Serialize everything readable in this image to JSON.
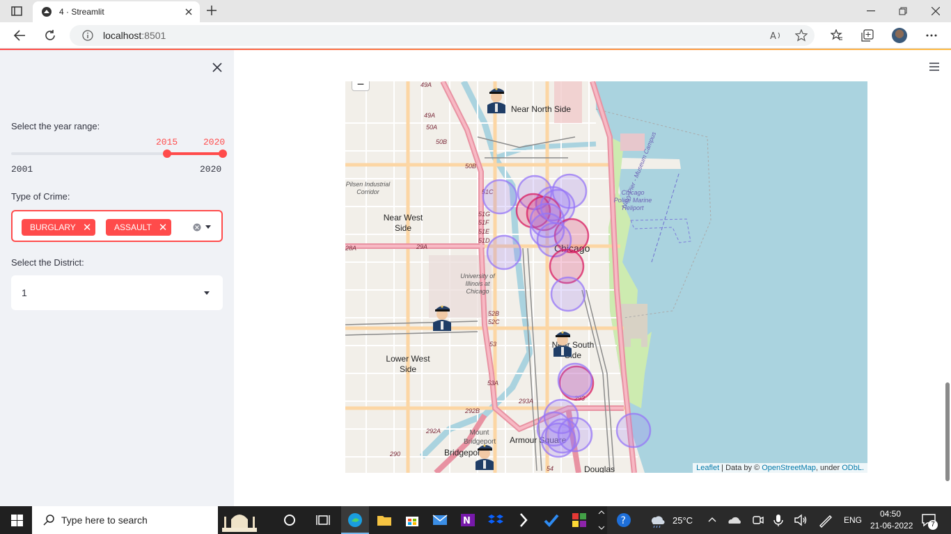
{
  "browser": {
    "tab_title": "4 · Streamlit",
    "url_host": "localhost",
    "url_port": ":8501"
  },
  "sidebar": {
    "year_label": "Select the year range:",
    "year_min": "2001",
    "year_max": "2020",
    "year_start": "2015",
    "year_end": "2020",
    "crime_label": "Type of Crime:",
    "crime_chips": [
      "BURGLARY",
      "ASSAULT"
    ],
    "district_label": "Select the District:",
    "district_value": "1"
  },
  "map": {
    "zoom_out": "−",
    "attribution_leaflet": "Leaflet",
    "attribution_mid": " | Data by © ",
    "attribution_osm": "OpenStreetMap",
    "attribution_under": ", under ",
    "attribution_odbl": "ODbL.",
    "labels": [
      "Near North Side",
      "Near West Side",
      "Chicago",
      "Lower West Side",
      "Near South Side",
      "Armour Square",
      "Bridgeport",
      "Douglas",
      "Mount Bridgeport",
      "Chicago Police Marine Heliport",
      "Navy Pier - Museum Campus",
      "University of Illinois at Chicago",
      "Pilsen Industrial Corridor"
    ],
    "highway_labels": [
      "49A",
      "49A",
      "50A",
      "50B",
      "50B",
      "51C",
      "51G",
      "51F",
      "51E",
      "51D",
      "29A",
      "28A",
      "52B",
      "52C",
      "53",
      "53A",
      "293A",
      "292B",
      "292A",
      "290",
      "54",
      "293"
    ],
    "colors": {
      "assault": "#d81b60",
      "burglary": "#9575f7",
      "water": "#aad3df",
      "park": "#cdebb0",
      "road": "#f7b9c4",
      "mainroad": "#fcd6a4"
    }
  },
  "taskbar": {
    "search_placeholder": "Type here to search",
    "temperature": "25°C",
    "language": "ENG",
    "time": "04:50",
    "date": "21-06-2022",
    "notification_count": "7"
  }
}
